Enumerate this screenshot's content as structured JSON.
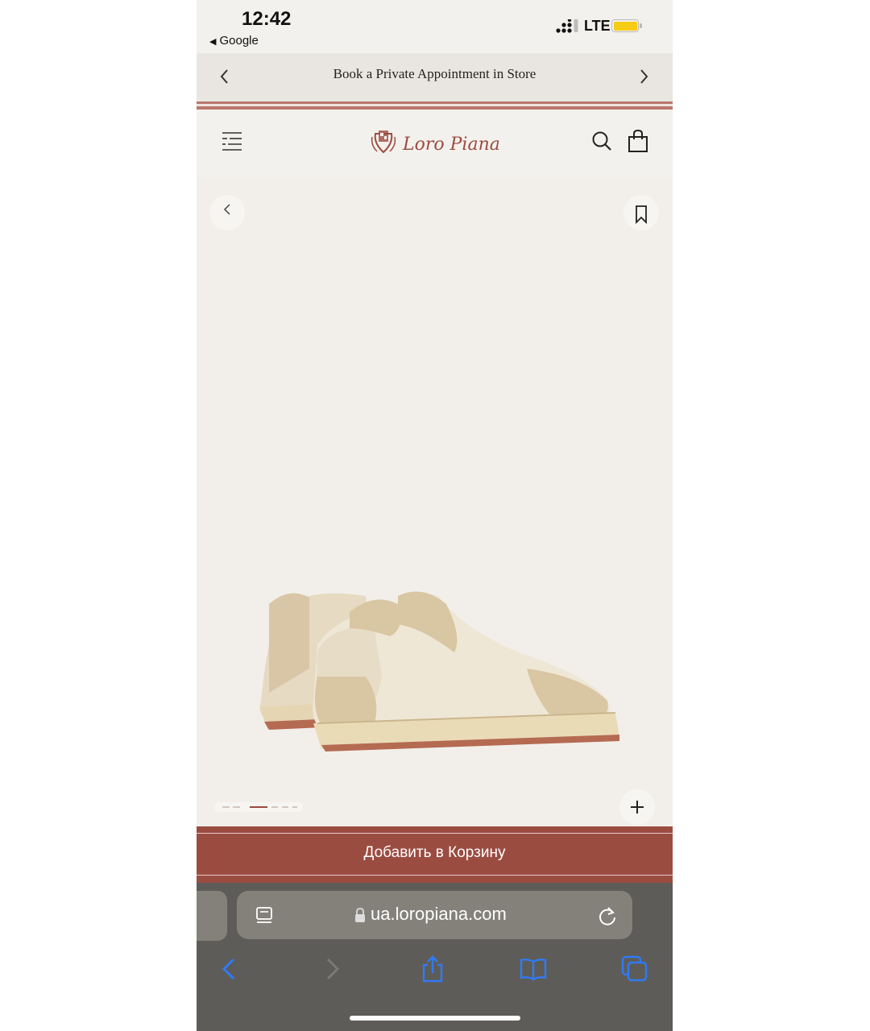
{
  "status_bar": {
    "time": "12:42",
    "back_app": "Google",
    "network": "LTE",
    "battery_color": "#f6cc15"
  },
  "announcement": {
    "text": "Book a Private Appointment in Store",
    "prev_icon": "chevron-left-icon",
    "next_icon": "chevron-right-icon"
  },
  "header": {
    "brand": "Loro Piana",
    "icons": [
      "menu-icon",
      "search-icon",
      "shopping-bag-icon"
    ]
  },
  "gallery": {
    "image_count": 6,
    "active_index": 2,
    "icons": [
      "chevron-left-icon",
      "bookmark-icon",
      "plus-icon"
    ]
  },
  "cart": {
    "button_label": "Добавить в Корзину",
    "color": "#9b4c41"
  },
  "browser": {
    "url": "ua.loropiana.com",
    "icons": [
      "reader-icon",
      "lock-icon",
      "reload-icon",
      "back-icon",
      "forward-icon",
      "share-icon",
      "bookmarks-icon",
      "tabs-icon"
    ],
    "accent": "#2f7bf6"
  }
}
